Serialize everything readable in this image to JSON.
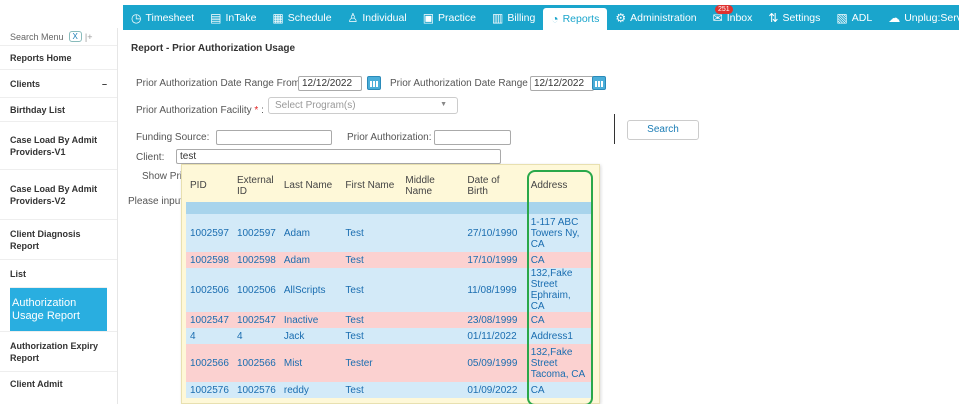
{
  "nav": {
    "items": [
      {
        "label": "Timesheet",
        "icon": "clock-icon"
      },
      {
        "label": "InTake",
        "icon": "intake-icon"
      },
      {
        "label": "Schedule",
        "icon": "calendar-icon"
      },
      {
        "label": "Individual",
        "icon": "person-icon"
      },
      {
        "label": "Practice",
        "icon": "practice-icon"
      },
      {
        "label": "Billing",
        "icon": "billing-icon"
      },
      {
        "label": "Reports",
        "icon": "reports-icon",
        "active": true
      },
      {
        "label": "Administration",
        "icon": "gear-icon"
      },
      {
        "label": "Inbox",
        "icon": "inbox-icon",
        "badge": "251"
      },
      {
        "label": "Settings",
        "icon": "settings-icon"
      },
      {
        "label": "ADL",
        "icon": "adl-icon"
      },
      {
        "label": "Unplug:Serve",
        "icon": "cloud-icon"
      }
    ]
  },
  "sidebar": {
    "search_label": "Search Menu",
    "clear_label": "X",
    "pin_label": "|+",
    "items": [
      {
        "label": "Reports Home"
      },
      {
        "label": "Clients",
        "collapse": "–"
      },
      {
        "label": "Birthday List"
      },
      {
        "label": "Case Load By Admit Providers-V1"
      },
      {
        "label": "Case Load By Admit Providers-V2"
      },
      {
        "label": "Client Diagnosis Report"
      },
      {
        "label": "List"
      },
      {
        "label": "Authorization Usage Report",
        "active": true
      },
      {
        "label": "Authorization Expiry Report"
      },
      {
        "label": "Client Admit"
      }
    ]
  },
  "form": {
    "title": "Report - Prior Authorization Usage",
    "date_from_label": "Prior Authorization Date Range From:",
    "date_from_value": "12/12/2022",
    "date_to_label": "Prior Authorization Date Range To:",
    "date_to_value": "12/12/2022",
    "facility_label": "Prior Authorization Facility",
    "facility_required": "*",
    "facility_colon": ":",
    "facility_placeholder": "Select Program(s)",
    "funding_label": "Funding Source:",
    "prior_auth_label": "Prior Authorization:",
    "client_label": "Client:",
    "client_value": "test",
    "show_label": "Show Pric",
    "please_label": "Please input",
    "search_button": "Search"
  },
  "popup": {
    "headers": [
      "PID",
      "External ID",
      "Last Name",
      "First Name",
      "Middle Name",
      "Date of Birth",
      "Address"
    ],
    "rows": [
      {
        "cells": [
          "1002597",
          "1002597",
          "Adam",
          "Test",
          "",
          "27/10/1990",
          "1-117 ABC Towers Ny, CA"
        ],
        "tone": "blue",
        "size": "tall"
      },
      {
        "cells": [
          "1002598",
          "1002598",
          "Adam",
          "Test",
          "",
          "17/10/1999",
          "CA"
        ],
        "tone": "pink",
        "size": "short"
      },
      {
        "cells": [
          "1002506",
          "1002506",
          "AllScripts",
          "Test",
          "",
          "11/08/1999",
          "132,Fake Street Ephraim, CA"
        ],
        "tone": "blue",
        "size": "tall"
      },
      {
        "cells": [
          "1002547",
          "1002547",
          "Inactive",
          "Test",
          "",
          "23/08/1999",
          "CA"
        ],
        "tone": "pink",
        "size": "short"
      },
      {
        "cells": [
          "4",
          "4",
          "Jack",
          "Test",
          "",
          "01/11/2022",
          "Address1"
        ],
        "tone": "blue",
        "size": "short"
      },
      {
        "cells": [
          "1002566",
          "1002566",
          "Mist",
          "Tester",
          "",
          "05/09/1999",
          "132,Fake Street Tacoma, CA"
        ],
        "tone": "pink",
        "size": "tall"
      },
      {
        "cells": [
          "1002576",
          "1002576",
          "reddy",
          "Test",
          "",
          "01/09/2022",
          "CA"
        ],
        "tone": "blue",
        "size": "short"
      }
    ]
  },
  "colors": {
    "nav_bg": "#1aa5cc",
    "active_sidebar": "#29aee0",
    "row_blue": "#d3eaf8",
    "row_pink": "#fbd1d0",
    "popup_bg": "#fef8d8",
    "highlight": "#2aa84a"
  }
}
